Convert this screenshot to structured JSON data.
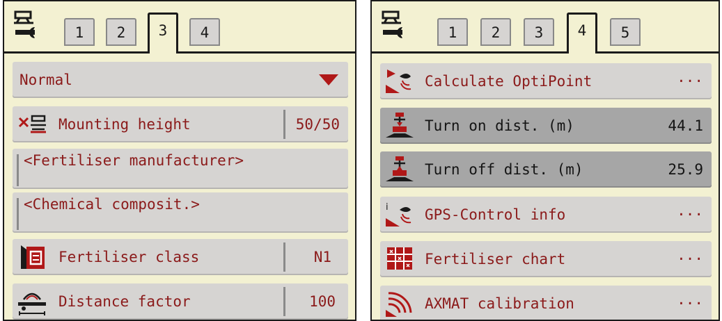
{
  "colors": {
    "panel_bg": "#f3f1d2",
    "row_bg": "#d6d4d2",
    "row_selected_bg": "#a6a6a6",
    "text_red": "#8b1a1a",
    "border": "#1a1a1a"
  },
  "left_panel": {
    "tool_icon": "tractor-wrench-icon",
    "tabs": [
      "1",
      "2",
      "3",
      "4"
    ],
    "active_tab": "3",
    "dropdown_value": "Normal",
    "mounting_height": {
      "label": "Mounting height",
      "value": "50/50",
      "icon": "mounting-height-icon"
    },
    "manufacturer_placeholder": "<Fertiliser manufacturer>",
    "composition_placeholder": "<Chemical composit.>",
    "fertiliser_class": {
      "label": "Fertiliser class",
      "value": "N1",
      "icon": "fertiliser-bag-icon"
    },
    "distance_factor": {
      "label": "Distance factor",
      "value": "100",
      "icon": "distance-factor-icon"
    }
  },
  "right_panel": {
    "tool_icon": "tractor-wrench-icon",
    "tabs": [
      "1",
      "2",
      "3",
      "4",
      "5"
    ],
    "active_tab": "4",
    "items": [
      {
        "label": "Calculate OptiPoint",
        "value": "···",
        "icon": "optipoint-icon"
      },
      {
        "label": "Turn on dist. (m)",
        "value": "44.1",
        "icon": "turn-on-distance-icon"
      },
      {
        "label": "Turn off dist. (m)",
        "value": "25.9",
        "icon": "turn-off-distance-icon"
      },
      {
        "label": "GPS-Control info",
        "value": "···",
        "icon": "gps-info-icon"
      },
      {
        "label": "Fertiliser chart",
        "value": "···",
        "icon": "fertiliser-chart-icon"
      },
      {
        "label": "AXMAT calibration",
        "value": "···",
        "icon": "axmat-calibration-icon"
      }
    ]
  }
}
